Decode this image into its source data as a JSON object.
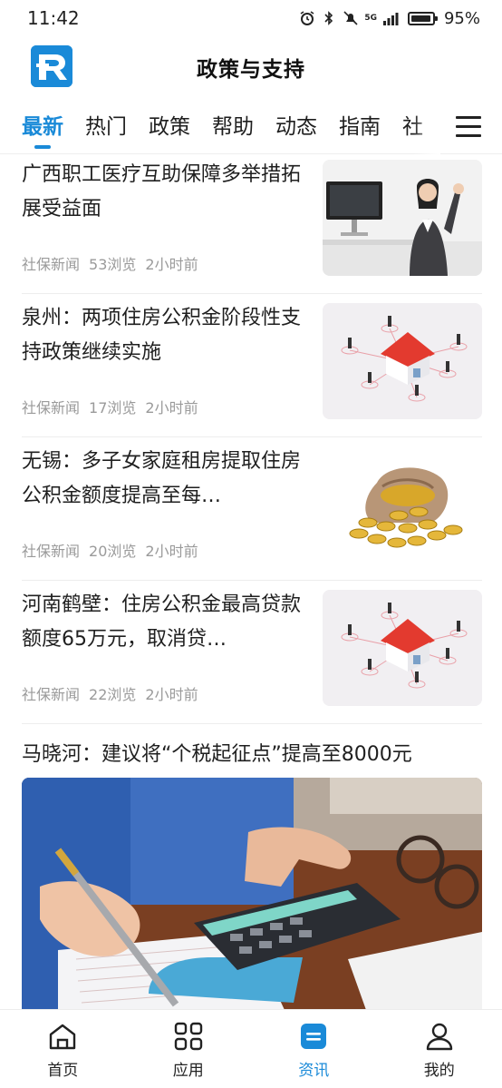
{
  "status_bar": {
    "time": "11:42",
    "network": "5G",
    "battery": "95%"
  },
  "header": {
    "title": "政策与支持"
  },
  "tabs": [
    {
      "label": "最新",
      "active": true
    },
    {
      "label": "热门",
      "active": false
    },
    {
      "label": "政策",
      "active": false
    },
    {
      "label": "帮助",
      "active": false
    },
    {
      "label": "动态",
      "active": false
    },
    {
      "label": "指南",
      "active": false
    },
    {
      "label": "社",
      "active": false
    }
  ],
  "news": [
    {
      "title": "广西职工医疗互助保障多举措拓展受益面",
      "source": "社保新闻",
      "views": "53浏览",
      "time": "2小时前",
      "image": "office-woman"
    },
    {
      "title": "泉州：两项住房公积金阶段性支持政策继续实施",
      "source": "社保新闻",
      "views": "17浏览",
      "time": "2小时前",
      "image": "house-network"
    },
    {
      "title": "无锡：多子女家庭租房提取住房公积金额度提高至每…",
      "source": "社保新闻",
      "views": "20浏览",
      "time": "2小时前",
      "image": "coin-sack"
    },
    {
      "title": "河南鹤壁：住房公积金最高贷款额度65万元，取消贷…",
      "source": "社保新闻",
      "views": "22浏览",
      "time": "2小时前",
      "image": "house-network"
    }
  ],
  "featured": {
    "title": "马晓河：建议将“个税起征点”提高至8000元",
    "image": "calculator-hands"
  },
  "bottom_nav": [
    {
      "label": "首页",
      "icon": "home-icon",
      "active": false
    },
    {
      "label": "应用",
      "icon": "apps-grid-icon",
      "active": false
    },
    {
      "label": "资讯",
      "icon": "news-icon",
      "active": true
    },
    {
      "label": "我的",
      "icon": "user-icon",
      "active": false
    }
  ],
  "colors": {
    "accent": "#1a8ad8",
    "meta_text": "#9a9a9a"
  }
}
